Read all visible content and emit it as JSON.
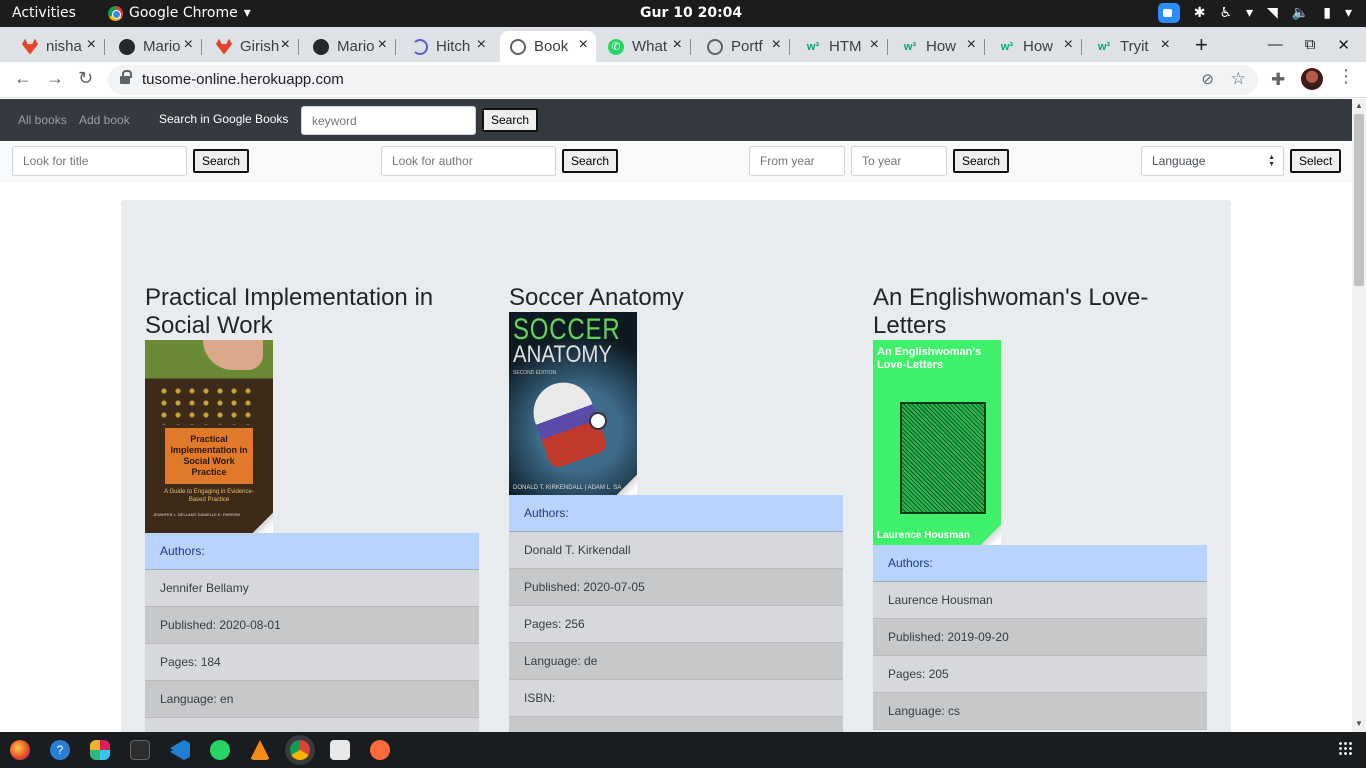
{
  "topbar": {
    "activities": "Activities",
    "app_name": "Google Chrome",
    "app_arrow": "▾",
    "clock": "Gur 10  20:04",
    "tray": {
      "menu_arrow": "▾",
      "menu_arrow2": "▾"
    }
  },
  "tabs": [
    {
      "title": "nisha",
      "icon": "gitlab-icon",
      "active": false
    },
    {
      "title": "Mario",
      "icon": "github-icon",
      "active": false
    },
    {
      "title": "Girish",
      "icon": "gitlab-icon",
      "active": false
    },
    {
      "title": "Mario",
      "icon": "github-icon",
      "active": false
    },
    {
      "title": "Hitch",
      "icon": "loading-icon",
      "active": false
    },
    {
      "title": "Book",
      "icon": "globe-icon",
      "active": true
    },
    {
      "title": "What",
      "icon": "whatsapp-icon",
      "active": false
    },
    {
      "title": "Portf",
      "icon": "globe-icon",
      "active": false
    },
    {
      "title": "HTM",
      "icon": "w3schools-icon",
      "active": false
    },
    {
      "title": "How",
      "icon": "w3schools-icon",
      "active": false
    },
    {
      "title": "How",
      "icon": "w3schools-icon",
      "active": false
    },
    {
      "title": "Tryit",
      "icon": "w3schools-icon",
      "active": false
    }
  ],
  "browser": {
    "url": "tusome-online.herokuapp.com",
    "new_tab": "+",
    "close_glyph": "×",
    "win_min": "—",
    "win_max": "⧉",
    "win_close": "✕"
  },
  "nav": {
    "all_books": "All books",
    "add_book": "Add book",
    "google_label": "Search in Google Books",
    "google_placeholder": "keyword",
    "google_search": "Search"
  },
  "filters": {
    "title_placeholder": "Look for title",
    "title_search": "Search",
    "author_placeholder": "Look for author",
    "author_search": "Search",
    "from_year_placeholder": "From year",
    "to_year_placeholder": "To year",
    "year_search": "Search",
    "language_selected": "Language",
    "language_select_button": "Select"
  },
  "books": [
    {
      "title": "Practical Implementation in Social Work",
      "cover_text": "Practical Implementation in Social Work Practice",
      "cover_subtitle": "A Guide to Engaging in Evidence-Based Practice",
      "cover_authors": "JENNIFER L. BELLAMY          DANIELLE E. PARRISH",
      "authors_label": "Authors:",
      "authors": "Jennifer Bellamy",
      "published": "Published: 2020-08-01",
      "pages": "Pages: 184",
      "language": "Language: en"
    },
    {
      "title": "Soccer Anatomy",
      "cover_line1": "SOCCER",
      "cover_line2": "ANATOMY",
      "cover_edition": "SECOND EDITION",
      "cover_authors": "DONALD T. KIRKENDALL | ADAM L. SA",
      "authors_label": "Authors:",
      "authors": "Donald T. Kirkendall",
      "published": "Published: 2020-07-05",
      "pages": "Pages: 256",
      "language": "Language: de",
      "isbn": "ISBN:"
    },
    {
      "title": "An Englishwoman's Love-Letters",
      "cover_text": "An Englishwoman's Love-Letters",
      "cover_author": "Laurence Housman",
      "authors_label": "Authors:",
      "authors": "Laurence Housman",
      "published": "Published: 2019-09-20",
      "pages": "Pages: 205",
      "language": "Language: cs"
    }
  ],
  "dock": [
    "firefox-icon",
    "help-icon",
    "slack-icon",
    "terminal-icon",
    "vscode-icon",
    "whatsapp-icon",
    "vlc-icon",
    "chrome-icon",
    "files-icon",
    "sublime-icon"
  ],
  "colors": {
    "navbar": "#343a40",
    "jumbotron": "#e9ecef",
    "list_head": "#b8d4fe",
    "accent_w3": "#04aa6d"
  }
}
